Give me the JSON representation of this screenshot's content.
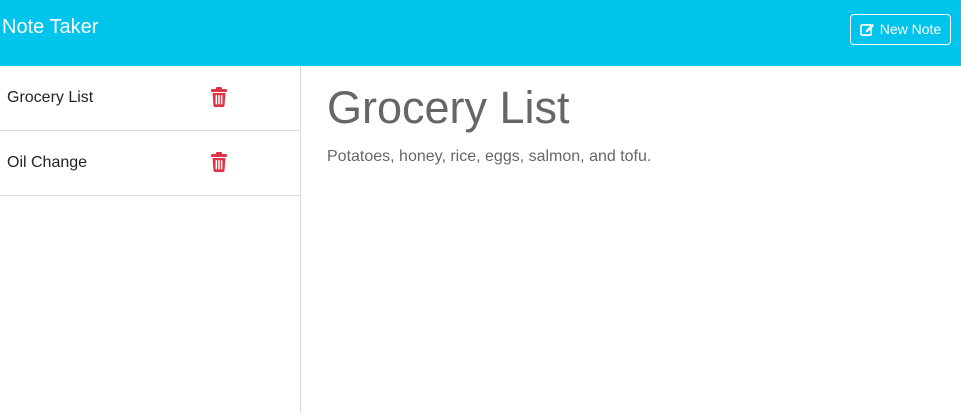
{
  "navbar": {
    "brand": "Note Taker",
    "new_note_label": "New Note",
    "new_note_icon": "pen-to-square-icon",
    "background_color": "#00c4ec"
  },
  "notes": [
    {
      "title": "Grocery List",
      "delete_icon": "trash-icon"
    },
    {
      "title": "Oil Change",
      "delete_icon": "trash-icon"
    }
  ],
  "active_note": {
    "title": "Grocery List",
    "text": "Potatoes, honey, rice, eggs, salmon, and tofu."
  },
  "colors": {
    "delete_icon": "#dc3545",
    "note_text": "#666666"
  }
}
